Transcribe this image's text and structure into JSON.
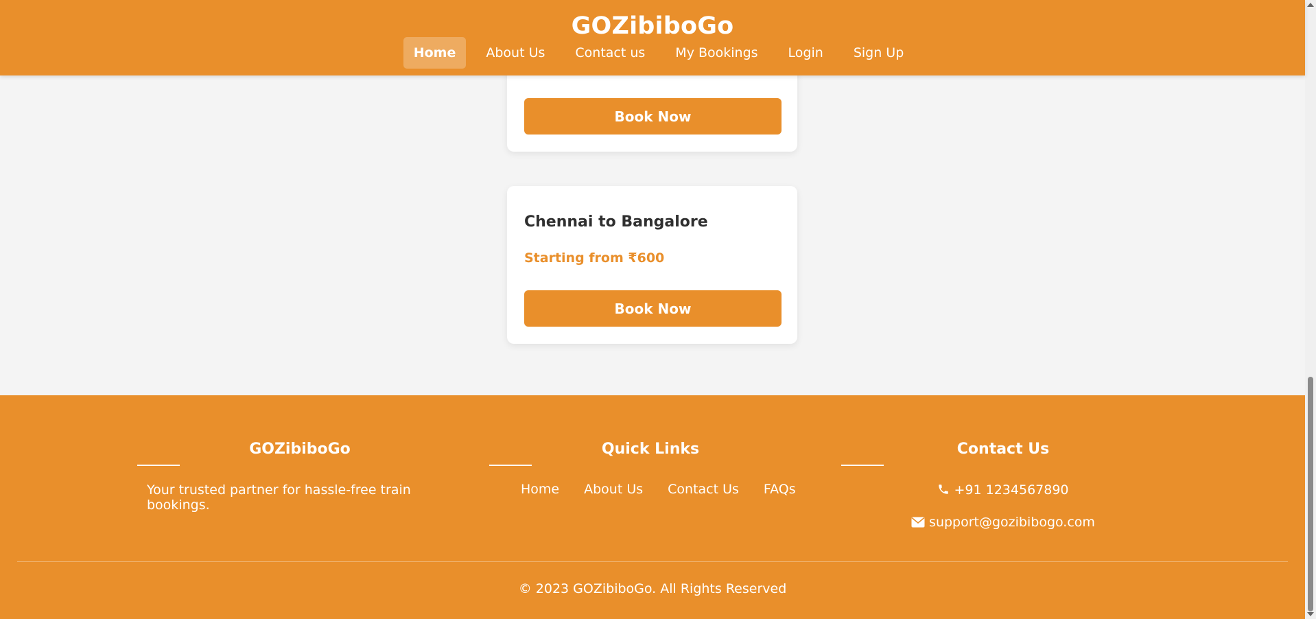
{
  "header": {
    "brand": "GOZibiboGo",
    "nav": [
      {
        "label": "Home",
        "active": true
      },
      {
        "label": "About Us"
      },
      {
        "label": "Contact us"
      },
      {
        "label": "My Bookings"
      },
      {
        "label": "Login"
      },
      {
        "label": "Sign Up"
      }
    ]
  },
  "routes": [
    {
      "title": "",
      "price": "",
      "button": "Book Now"
    },
    {
      "title": "Chennai to Bangalore",
      "price": "Starting from ₹600",
      "button": "Book Now"
    }
  ],
  "footer": {
    "about": {
      "heading": "GOZibiboGo",
      "text": "Your trusted partner for hassle-free train bookings."
    },
    "quick_links": {
      "heading": "Quick Links",
      "links": [
        "Home",
        "About Us",
        "Contact Us",
        "FAQs"
      ]
    },
    "contact": {
      "heading": "Contact Us",
      "phone": "+91 1234567890",
      "email": "support@gozibibogo.com",
      "phone_icon": "phone-icon",
      "email_icon": "envelope-icon"
    },
    "copyright": "© 2023 GOZibiboGo. All Rights Reserved"
  },
  "colors": {
    "accent": "#e98f2b",
    "background": "#f4f4f4",
    "card": "#ffffff",
    "title_text": "#2f2f2f"
  }
}
